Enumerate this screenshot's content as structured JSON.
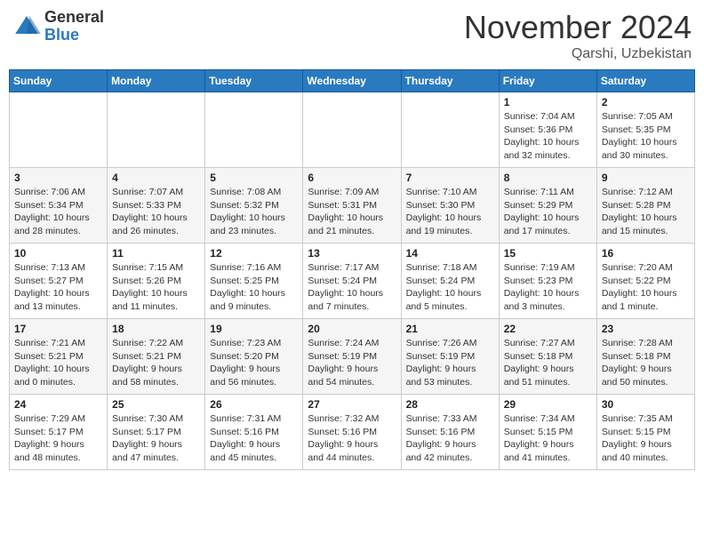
{
  "header": {
    "logo_general": "General",
    "logo_blue": "Blue",
    "month_title": "November 2024",
    "location": "Qarshi, Uzbekistan"
  },
  "calendar": {
    "days_of_week": [
      "Sunday",
      "Monday",
      "Tuesday",
      "Wednesday",
      "Thursday",
      "Friday",
      "Saturday"
    ],
    "weeks": [
      [
        {
          "day": "",
          "info": ""
        },
        {
          "day": "",
          "info": ""
        },
        {
          "day": "",
          "info": ""
        },
        {
          "day": "",
          "info": ""
        },
        {
          "day": "",
          "info": ""
        },
        {
          "day": "1",
          "info": "Sunrise: 7:04 AM\nSunset: 5:36 PM\nDaylight: 10 hours\nand 32 minutes."
        },
        {
          "day": "2",
          "info": "Sunrise: 7:05 AM\nSunset: 5:35 PM\nDaylight: 10 hours\nand 30 minutes."
        }
      ],
      [
        {
          "day": "3",
          "info": "Sunrise: 7:06 AM\nSunset: 5:34 PM\nDaylight: 10 hours\nand 28 minutes."
        },
        {
          "day": "4",
          "info": "Sunrise: 7:07 AM\nSunset: 5:33 PM\nDaylight: 10 hours\nand 26 minutes."
        },
        {
          "day": "5",
          "info": "Sunrise: 7:08 AM\nSunset: 5:32 PM\nDaylight: 10 hours\nand 23 minutes."
        },
        {
          "day": "6",
          "info": "Sunrise: 7:09 AM\nSunset: 5:31 PM\nDaylight: 10 hours\nand 21 minutes."
        },
        {
          "day": "7",
          "info": "Sunrise: 7:10 AM\nSunset: 5:30 PM\nDaylight: 10 hours\nand 19 minutes."
        },
        {
          "day": "8",
          "info": "Sunrise: 7:11 AM\nSunset: 5:29 PM\nDaylight: 10 hours\nand 17 minutes."
        },
        {
          "day": "9",
          "info": "Sunrise: 7:12 AM\nSunset: 5:28 PM\nDaylight: 10 hours\nand 15 minutes."
        }
      ],
      [
        {
          "day": "10",
          "info": "Sunrise: 7:13 AM\nSunset: 5:27 PM\nDaylight: 10 hours\nand 13 minutes."
        },
        {
          "day": "11",
          "info": "Sunrise: 7:15 AM\nSunset: 5:26 PM\nDaylight: 10 hours\nand 11 minutes."
        },
        {
          "day": "12",
          "info": "Sunrise: 7:16 AM\nSunset: 5:25 PM\nDaylight: 10 hours\nand 9 minutes."
        },
        {
          "day": "13",
          "info": "Sunrise: 7:17 AM\nSunset: 5:24 PM\nDaylight: 10 hours\nand 7 minutes."
        },
        {
          "day": "14",
          "info": "Sunrise: 7:18 AM\nSunset: 5:24 PM\nDaylight: 10 hours\nand 5 minutes."
        },
        {
          "day": "15",
          "info": "Sunrise: 7:19 AM\nSunset: 5:23 PM\nDaylight: 10 hours\nand 3 minutes."
        },
        {
          "day": "16",
          "info": "Sunrise: 7:20 AM\nSunset: 5:22 PM\nDaylight: 10 hours\nand 1 minute."
        }
      ],
      [
        {
          "day": "17",
          "info": "Sunrise: 7:21 AM\nSunset: 5:21 PM\nDaylight: 10 hours\nand 0 minutes."
        },
        {
          "day": "18",
          "info": "Sunrise: 7:22 AM\nSunset: 5:21 PM\nDaylight: 9 hours\nand 58 minutes."
        },
        {
          "day": "19",
          "info": "Sunrise: 7:23 AM\nSunset: 5:20 PM\nDaylight: 9 hours\nand 56 minutes."
        },
        {
          "day": "20",
          "info": "Sunrise: 7:24 AM\nSunset: 5:19 PM\nDaylight: 9 hours\nand 54 minutes."
        },
        {
          "day": "21",
          "info": "Sunrise: 7:26 AM\nSunset: 5:19 PM\nDaylight: 9 hours\nand 53 minutes."
        },
        {
          "day": "22",
          "info": "Sunrise: 7:27 AM\nSunset: 5:18 PM\nDaylight: 9 hours\nand 51 minutes."
        },
        {
          "day": "23",
          "info": "Sunrise: 7:28 AM\nSunset: 5:18 PM\nDaylight: 9 hours\nand 50 minutes."
        }
      ],
      [
        {
          "day": "24",
          "info": "Sunrise: 7:29 AM\nSunset: 5:17 PM\nDaylight: 9 hours\nand 48 minutes."
        },
        {
          "day": "25",
          "info": "Sunrise: 7:30 AM\nSunset: 5:17 PM\nDaylight: 9 hours\nand 47 minutes."
        },
        {
          "day": "26",
          "info": "Sunrise: 7:31 AM\nSunset: 5:16 PM\nDaylight: 9 hours\nand 45 minutes."
        },
        {
          "day": "27",
          "info": "Sunrise: 7:32 AM\nSunset: 5:16 PM\nDaylight: 9 hours\nand 44 minutes."
        },
        {
          "day": "28",
          "info": "Sunrise: 7:33 AM\nSunset: 5:16 PM\nDaylight: 9 hours\nand 42 minutes."
        },
        {
          "day": "29",
          "info": "Sunrise: 7:34 AM\nSunset: 5:15 PM\nDaylight: 9 hours\nand 41 minutes."
        },
        {
          "day": "30",
          "info": "Sunrise: 7:35 AM\nSunset: 5:15 PM\nDaylight: 9 hours\nand 40 minutes."
        }
      ]
    ]
  }
}
